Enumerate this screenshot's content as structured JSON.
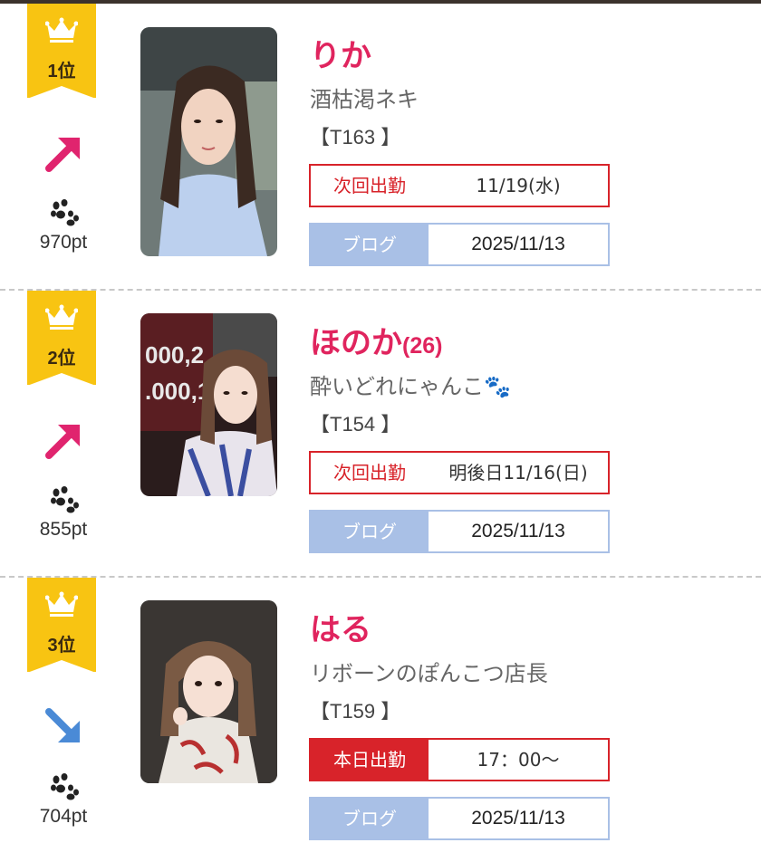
{
  "ranking": [
    {
      "rank_label": "1位",
      "trend": "up",
      "trend_icon": "arrow-up-right-icon",
      "trend_color": "#e0246e",
      "points": "970pt",
      "name": "りか",
      "age": "",
      "catchphrase": "酒枯渇ネキ",
      "height": "【T163 】",
      "shift_label": "次回出勤",
      "shift_date": "11/19(水)",
      "shift_today": false,
      "blog_label": "ブログ",
      "blog_date": "2025/11/13"
    },
    {
      "rank_label": "2位",
      "trend": "up",
      "trend_icon": "arrow-up-right-icon",
      "trend_color": "#e0246e",
      "points": "855pt",
      "name": "ほのか",
      "age": "(26)",
      "catchphrase": "酔いどれにゃんこ🐾",
      "height": "【T154 】",
      "shift_label": "次回出勤",
      "shift_date": "明後日11/16(日)",
      "shift_today": false,
      "blog_label": "ブログ",
      "blog_date": "2025/11/13"
    },
    {
      "rank_label": "3位",
      "trend": "down",
      "trend_icon": "arrow-down-right-icon",
      "trend_color": "#4a8ad6",
      "points": "704pt",
      "name": "はる",
      "age": "",
      "catchphrase": "リボーンのぽんこつ店長",
      "height": "【T159 】",
      "shift_label": "本日出勤",
      "shift_date": "17：00〜",
      "shift_today": true,
      "blog_label": "ブログ",
      "blog_date": "2025/11/13"
    }
  ],
  "colors": {
    "badge": "#f8c412",
    "name": "#e0245e",
    "shift_border": "#d8232a",
    "blog_blue": "#a9c0e6"
  }
}
